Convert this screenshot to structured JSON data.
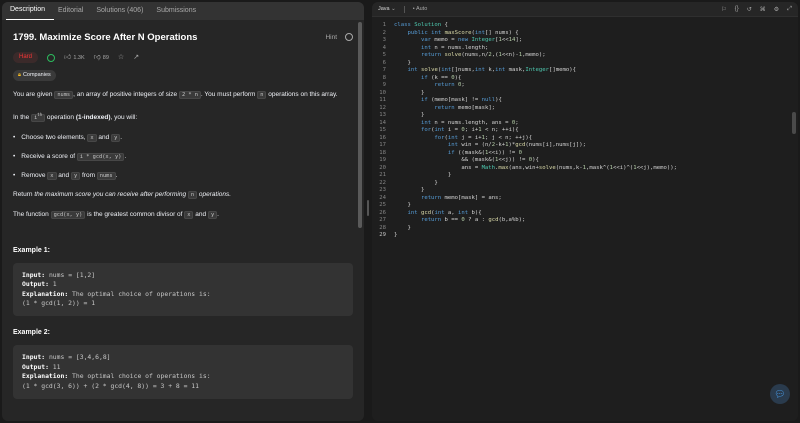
{
  "tabs": [
    "Description",
    "Editorial",
    "Solutions (406)",
    "Submissions"
  ],
  "problem": {
    "title": "1799. Maximize Score After N Operations",
    "hint": "Hint",
    "difficulty": "Hard",
    "likes": "1.3K",
    "dislikes": "89",
    "companies": "Companies"
  },
  "description": {
    "p1": [
      "You are given ",
      "nums",
      ", an array of positive integers of size ",
      "2 * n",
      ". You must perform ",
      "n",
      " operations on this array."
    ],
    "p2": [
      "In the ",
      "i",
      "th",
      " operation ",
      "(1-indexed)",
      ", you will:"
    ],
    "b1": [
      "Choose two elements, ",
      "x",
      " and ",
      "y",
      "."
    ],
    "b2": [
      "Receive a score of ",
      "i * gcd(x, y)",
      "."
    ],
    "b3": [
      "Remove ",
      "x",
      " and ",
      "y",
      " from ",
      "nums",
      "."
    ],
    "p3": [
      "Return ",
      "the maximum score you can receive after performing ",
      "n",
      " operations."
    ],
    "p4": [
      "The function ",
      "gcd(x, y)",
      " is the greatest common divisor of ",
      "x",
      " and ",
      "y",
      "."
    ]
  },
  "examples": [
    {
      "title": "Example 1:",
      "input_label": "Input:",
      "input": "nums = [1,2]",
      "output_label": "Output:",
      "output": "1",
      "explanation_label": "Explanation:",
      "explanation": "The optimal choice of operations is:",
      "explanation_line2": "(1 * gcd(1, 2)) = 1"
    },
    {
      "title": "Example 2:",
      "input_label": "Input:",
      "input": "nums = [3,4,6,8]",
      "output_label": "Output:",
      "output": "11",
      "explanation_label": "Explanation:",
      "explanation": "The optimal choice of operations is:",
      "explanation_line2": "(1 * gcd(3, 6)) + (2 * gcd(4, 8)) = 3 + 8 = 11"
    }
  ],
  "editor": {
    "language": "Java",
    "mode": "Auto",
    "code": [
      "class Solution {",
      "    public int maxScore(int[] nums) {",
      "        var memo = new Integer[1<<14];",
      "        int n = nums.length;",
      "        return solve(nums,n/2,(1<<n)-1,memo);",
      "    }",
      "    int solve(int[]nums,int k,int mask,Integer[]memo){",
      "        if (k == 0){",
      "            return 0;",
      "        }",
      "        if (memo[mask] != null){",
      "            return memo[mask];",
      "        }",
      "        int n = nums.length, ans = 0;",
      "        for(int i = 0; i+1 < n; ++i){",
      "            for(int j = i+1; j < n; ++j){",
      "                int win = (n/2-k+1)*gcd(nums[i],nums[j]);",
      "                if ((mask&(1<<i)) != 0",
      "                    && (mask&(1<<j)) != 0){",
      "                    ans = Math.max(ans,win+solve(nums,k-1,mask^(1<<i)^(1<<j),memo));",
      "                }",
      "            }",
      "        }",
      "        return memo[mask] = ans;",
      "    }",
      "    int gcd(int a, int b){",
      "        return b == 0 ? a : gcd(b,a%b);",
      "    }",
      "}"
    ]
  },
  "icons": {
    "hint": "hint-icon",
    "accepted": "check-circle-icon",
    "like": "thumbs-up-icon",
    "dislike": "thumbs-down-icon",
    "star": "star-icon",
    "share": "share-icon",
    "lock": "lock-icon",
    "chat": "chat-icon"
  },
  "colors": {
    "hard": "#f63636",
    "accepted": "#2cbb5d",
    "lock": "#ffc01e",
    "keyword": "#569cd6",
    "type": "#4ec9b0"
  }
}
